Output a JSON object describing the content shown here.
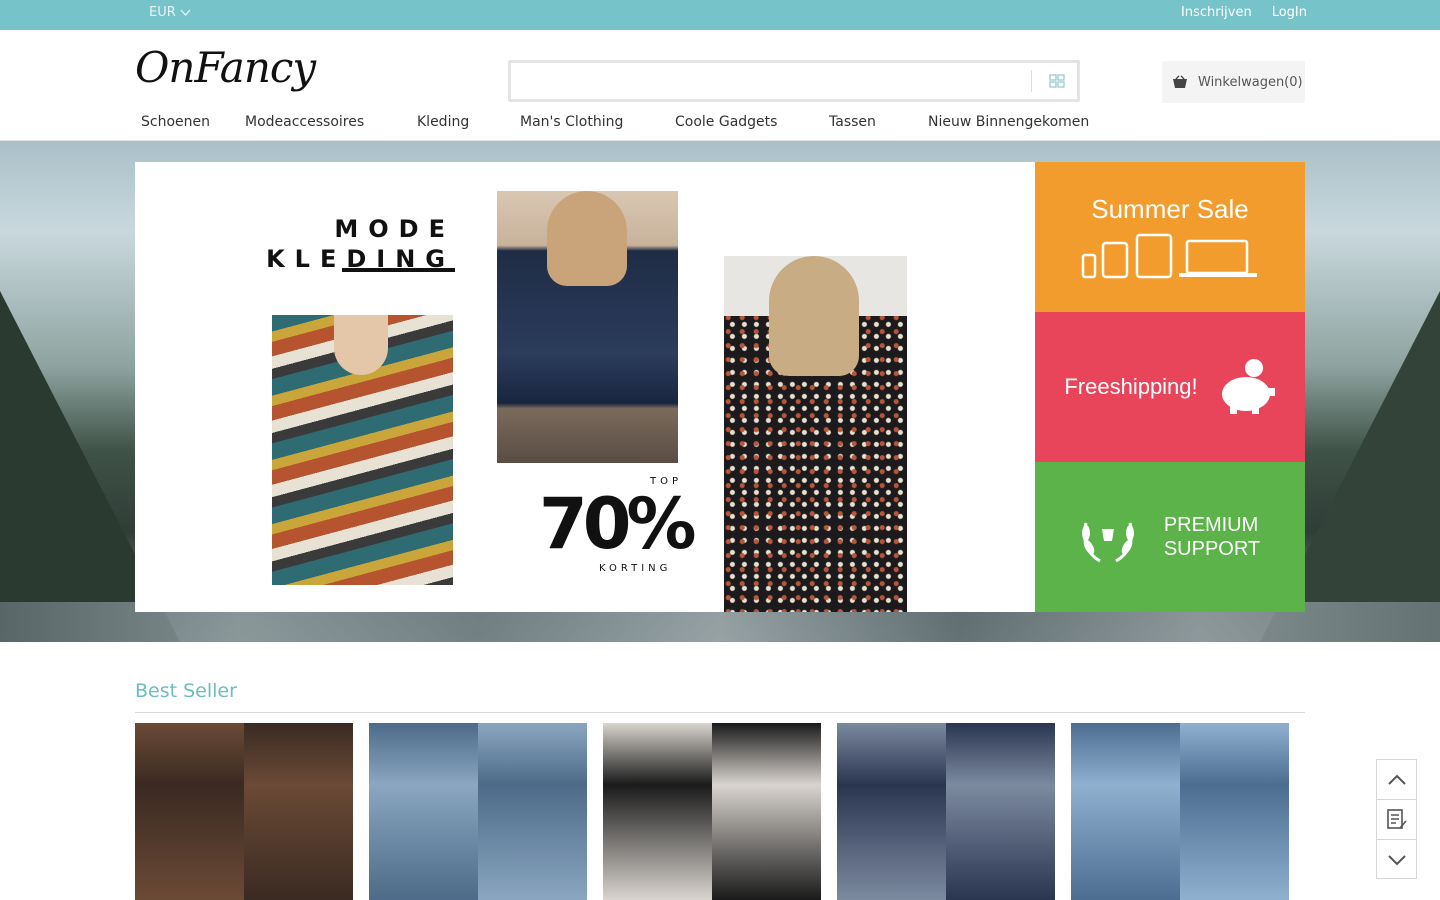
{
  "topbar": {
    "currency": "EUR",
    "links": {
      "register": "Inschrijven",
      "login": "LogIn"
    }
  },
  "header": {
    "logo": "OnFancy",
    "search": {
      "value": "",
      "placeholder": ""
    },
    "cart_label": "Winkelwagen(0)"
  },
  "nav": {
    "items": [
      "Schoenen",
      "Modeaccessoires",
      "Kleding",
      "Man's Clothing",
      "Coole Gadgets",
      "Tassen",
      "Nieuw Binnengekomen"
    ]
  },
  "banner": {
    "title_line1": "MODE",
    "title_line2": "KLEDING",
    "top_label": "TOP",
    "discount": "70%",
    "discount_label": "KORTING"
  },
  "side_banners": {
    "sale": "Summer Sale",
    "shipping": "Freeshipping!",
    "support_line1": "PREMIUM",
    "support_line2": "SUPPORT"
  },
  "best_seller": {
    "title": "Best Seller",
    "products": [
      {
        "colors": [
          "#3a2a22",
          "#6b4a36"
        ]
      },
      {
        "colors": [
          "#8aa6c0",
          "#4d6a88"
        ]
      },
      {
        "colors": [
          "#1a1a1a",
          "#d9d4cf"
        ]
      },
      {
        "colors": [
          "#2a3550",
          "#7c8aa0"
        ]
      },
      {
        "colors": [
          "#8fb0cf",
          "#4c6d90"
        ]
      }
    ]
  },
  "colors": {
    "topbar": "#76c3c9",
    "accent": "#6bbcc3",
    "sale": "#f39c2e",
    "shipping": "#e8455b",
    "support": "#5bb34a"
  },
  "icons": {
    "currency_chevron": "chevron-down-icon",
    "search": "grid-search-icon",
    "cart": "basket-icon",
    "sale": "devices-icon",
    "shipping": "piggy-bank-icon",
    "support": "laurel-icon",
    "tools": [
      "arrow-up-icon",
      "notepad-icon",
      "arrow-down-icon"
    ]
  }
}
